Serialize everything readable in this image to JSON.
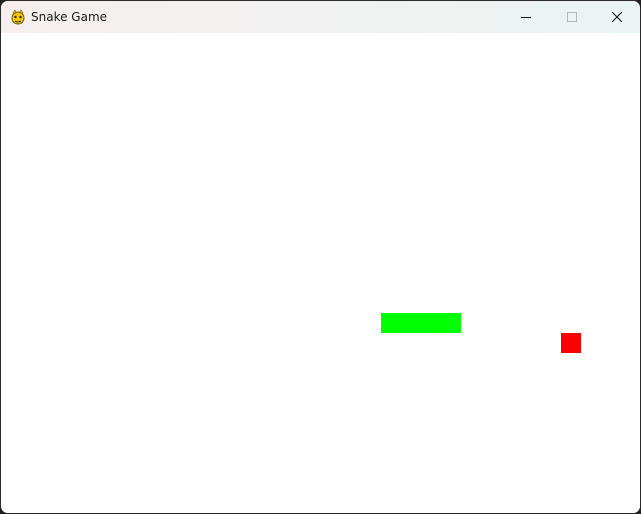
{
  "window": {
    "title": "Snake Game",
    "app_icon": "pygame-snake-icon",
    "controls": [
      "minimize-icon",
      "maximize-icon",
      "close-icon"
    ]
  },
  "game": {
    "grid_cell": 20,
    "snake_color": "#00ff00",
    "food_color": "#ff0000",
    "background_color": "#ffffff",
    "snake_cells": [
      [
        19,
        14
      ],
      [
        20,
        14
      ],
      [
        21,
        14
      ],
      [
        22,
        14
      ]
    ],
    "food_cell": [
      28,
      15
    ]
  }
}
